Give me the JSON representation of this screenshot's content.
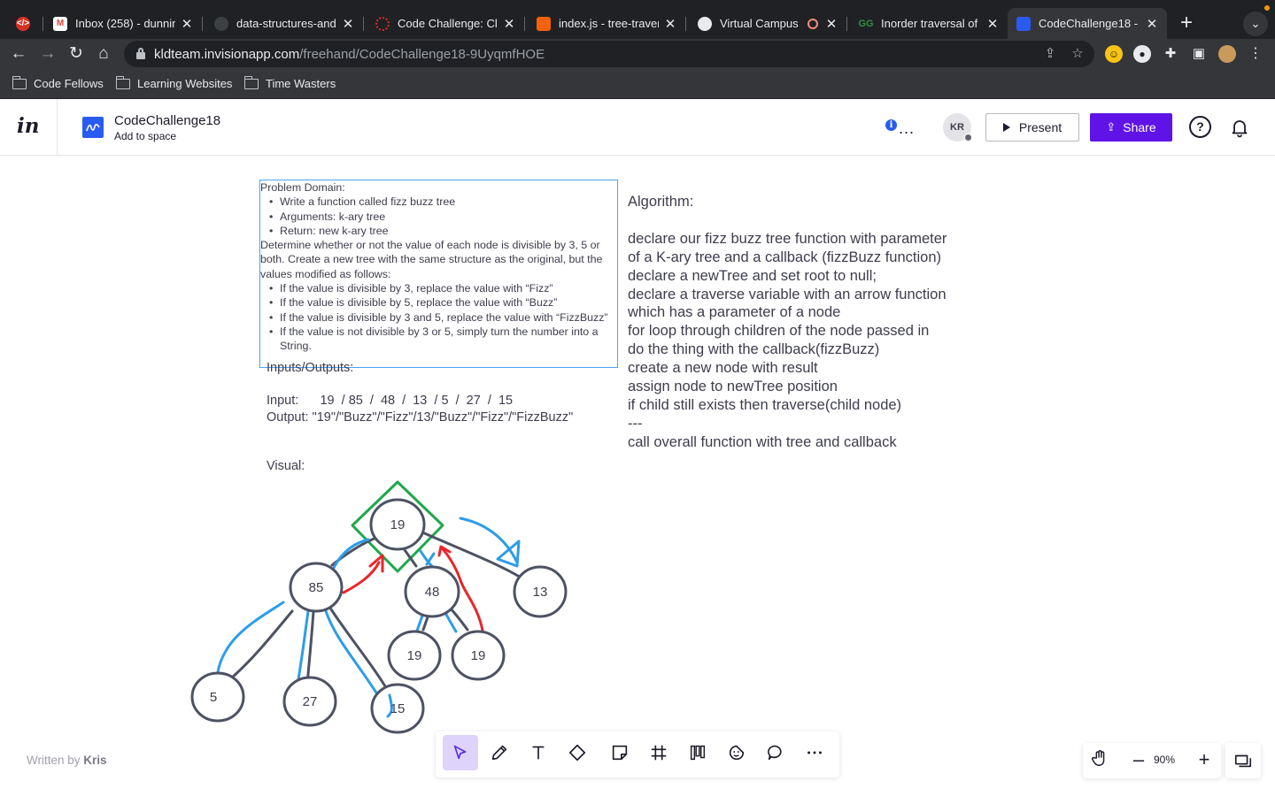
{
  "browser": {
    "tabs": [
      {
        "title": "",
        "icon": "devtools-icon",
        "color": "#d93025"
      },
      {
        "title": "Inbox (258) - dunnin",
        "icon": "gmail-icon",
        "color": "#ea4335"
      },
      {
        "title": "data-structures-and",
        "icon": "github-icon",
        "color": "#3c4043"
      },
      {
        "title": "Code Challenge: Cla",
        "icon": "canvas-icon",
        "color": "#d93025"
      },
      {
        "title": "index.js - tree-traver",
        "icon": "replit-icon",
        "color": "#f26207"
      },
      {
        "title": "Virtual Campus",
        "icon": "globe-icon",
        "color": "#e8eaed"
      },
      {
        "title": "Inorder traversal of a",
        "icon": "gfg-icon",
        "color": "#2f8d46"
      },
      {
        "title": "CodeChallenge18 - I",
        "icon": "freehand-icon",
        "color": "#2a5bf0"
      }
    ],
    "url_host": "kldteam.invisionapp.com",
    "url_path": "/freehand/CodeChallenge18-9UyqmfHOE",
    "bookmarks": [
      "Code Fellows",
      "Learning Websites",
      "Time Wasters"
    ]
  },
  "app": {
    "logo": "in",
    "doc_title": "CodeChallenge18",
    "doc_subtitle": "Add to space",
    "more": "...",
    "avatar_initials": "KR",
    "present_label": "Present",
    "share_label": "Share",
    "help": "?",
    "accent": "#6013e6"
  },
  "board": {
    "problem_title": "Problem Domain:",
    "problem_bullets": [
      "Write a function called fizz buzz tree",
      "Arguments: k-ary tree",
      "Return: new k-ary tree"
    ],
    "problem_text": "Determine whether or not the value of each node is divisible by 3, 5 or both. Create a new tree with the same structure as the original, but the values modified as follows:",
    "rule_bullets": [
      "If the value is divisible by 3, replace the value with “Fizz”",
      "If the value is divisible by 5, replace the value with “Buzz”",
      "If the value is divisible by 3 and 5, replace the value with “FizzBuzz”",
      "If the value is not divisible by 3 or 5, simply turn the number into a String."
    ],
    "io_label": "Inputs/Outputs:",
    "input_line": "Input:      19  / 85  /  48  /  13  / 5  /  27  /  15",
    "output_line": "Output: \"19\"/\"Buzz\"/\"Fizz\"/13/\"Buzz\"/\"Fizz\"/\"FizzBuzz\"",
    "visual_label": "Visual:",
    "algorithm_title": "Algorithm:",
    "algorithm_lines": [
      "declare our fizz buzz tree function with parameter",
      "of a K-ary tree and a callback (fizzBuzz function)",
      "declare a newTree and set root to null;",
      "declare a traverse variable with an arrow function",
      "which has a parameter of a node",
      "for loop through children of the node passed in",
      "do the thing with the callback(fizzBuzz)",
      "create a new node with result",
      "assign node to newTree position",
      "if child still exists then traverse(child node)",
      "---",
      "call overall function with tree and callback"
    ],
    "tree_nodes": [
      "19",
      "85",
      "48",
      "13",
      "19",
      "19",
      "5",
      "27",
      "15"
    ]
  },
  "footer": {
    "written_by": "Written by",
    "author": "Kris",
    "zoom": "90%"
  }
}
